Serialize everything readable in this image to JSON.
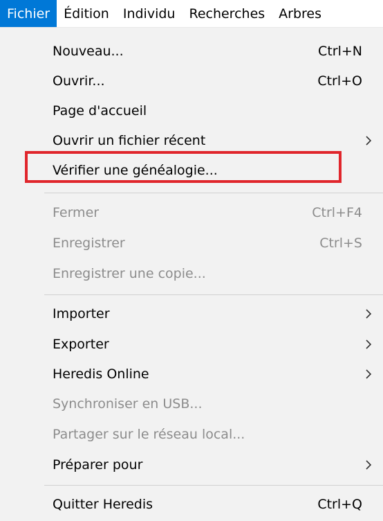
{
  "menubar": {
    "items": [
      {
        "label": "Fichier"
      },
      {
        "label": "Édition"
      },
      {
        "label": "Individu"
      },
      {
        "label": "Recherches"
      },
      {
        "label": "Arbres"
      }
    ]
  },
  "menu": {
    "nouveau": {
      "label": "Nouveau...",
      "shortcut": "Ctrl+N"
    },
    "ouvrir": {
      "label": "Ouvrir...",
      "shortcut": "Ctrl+O"
    },
    "page_accueil": {
      "label": "Page d'accueil"
    },
    "recent": {
      "label": "Ouvrir un fichier récent"
    },
    "verifier": {
      "label": "Vérifier une généalogie..."
    },
    "fermer": {
      "label": "Fermer",
      "shortcut": "Ctrl+F4"
    },
    "enregistrer": {
      "label": "Enregistrer",
      "shortcut": "Ctrl+S"
    },
    "enregistrer_copie": {
      "label": "Enregistrer une copie..."
    },
    "importer": {
      "label": "Importer"
    },
    "exporter": {
      "label": "Exporter"
    },
    "heredis_online": {
      "label": "Heredis Online"
    },
    "synchroniser": {
      "label": "Synchroniser en USB..."
    },
    "partager": {
      "label": "Partager sur le réseau local..."
    },
    "preparer": {
      "label": "Préparer pour"
    },
    "quitter": {
      "label": "Quitter Heredis",
      "shortcut": "Ctrl+Q"
    }
  },
  "colors": {
    "active_menu_bg": "#0078d7",
    "highlight_box": "#e0262c",
    "disabled_text": "#8c8c8c"
  }
}
